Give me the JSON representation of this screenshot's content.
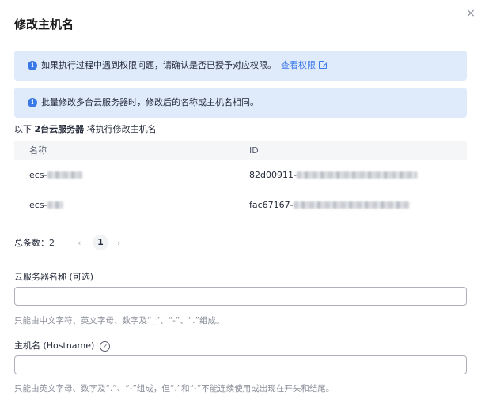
{
  "dialog": {
    "title": "修改主机名",
    "close_glyph": "×"
  },
  "alerts": [
    {
      "icon": "info-icon",
      "text": "如果执行过程中遇到权限问题，请确认是否已授予对应权限。",
      "link_text": "查看权限",
      "link_icon": "external-link-icon"
    },
    {
      "icon": "info-icon",
      "text": "批量修改多台云服务器时，修改后的名称或主机名相同。"
    }
  ],
  "summary": {
    "prefix": "以下",
    "count_text": "2台云服务器",
    "suffix": "将执行修改主机名"
  },
  "table": {
    "columns": [
      "名称",
      "ID"
    ],
    "rows": [
      {
        "name": "ecs-",
        "id": "82d00911-"
      },
      {
        "name": "ecs-",
        "id": "fac67167-"
      }
    ]
  },
  "pagination": {
    "total_label": "总条数：2",
    "prev": "‹",
    "current_page": "1",
    "next": "›"
  },
  "fields": [
    {
      "label": "云服务器名称 (可选)",
      "value": "",
      "hint": "只能由中文字符、英文字母、数字及“_”、“-”、“.”组成。"
    },
    {
      "label": "主机名 (Hostname)",
      "help_icon": "question-circle-icon",
      "value": "",
      "hint": "只能由英文字母、数字及“.”、“-”组成，但“.”和“-”不能连续使用或出现在开头和结尾。"
    }
  ],
  "colors": {
    "accent": "#3b78e7",
    "alert_bg": "#dfeafb",
    "header_bg": "#f5f6f8"
  }
}
